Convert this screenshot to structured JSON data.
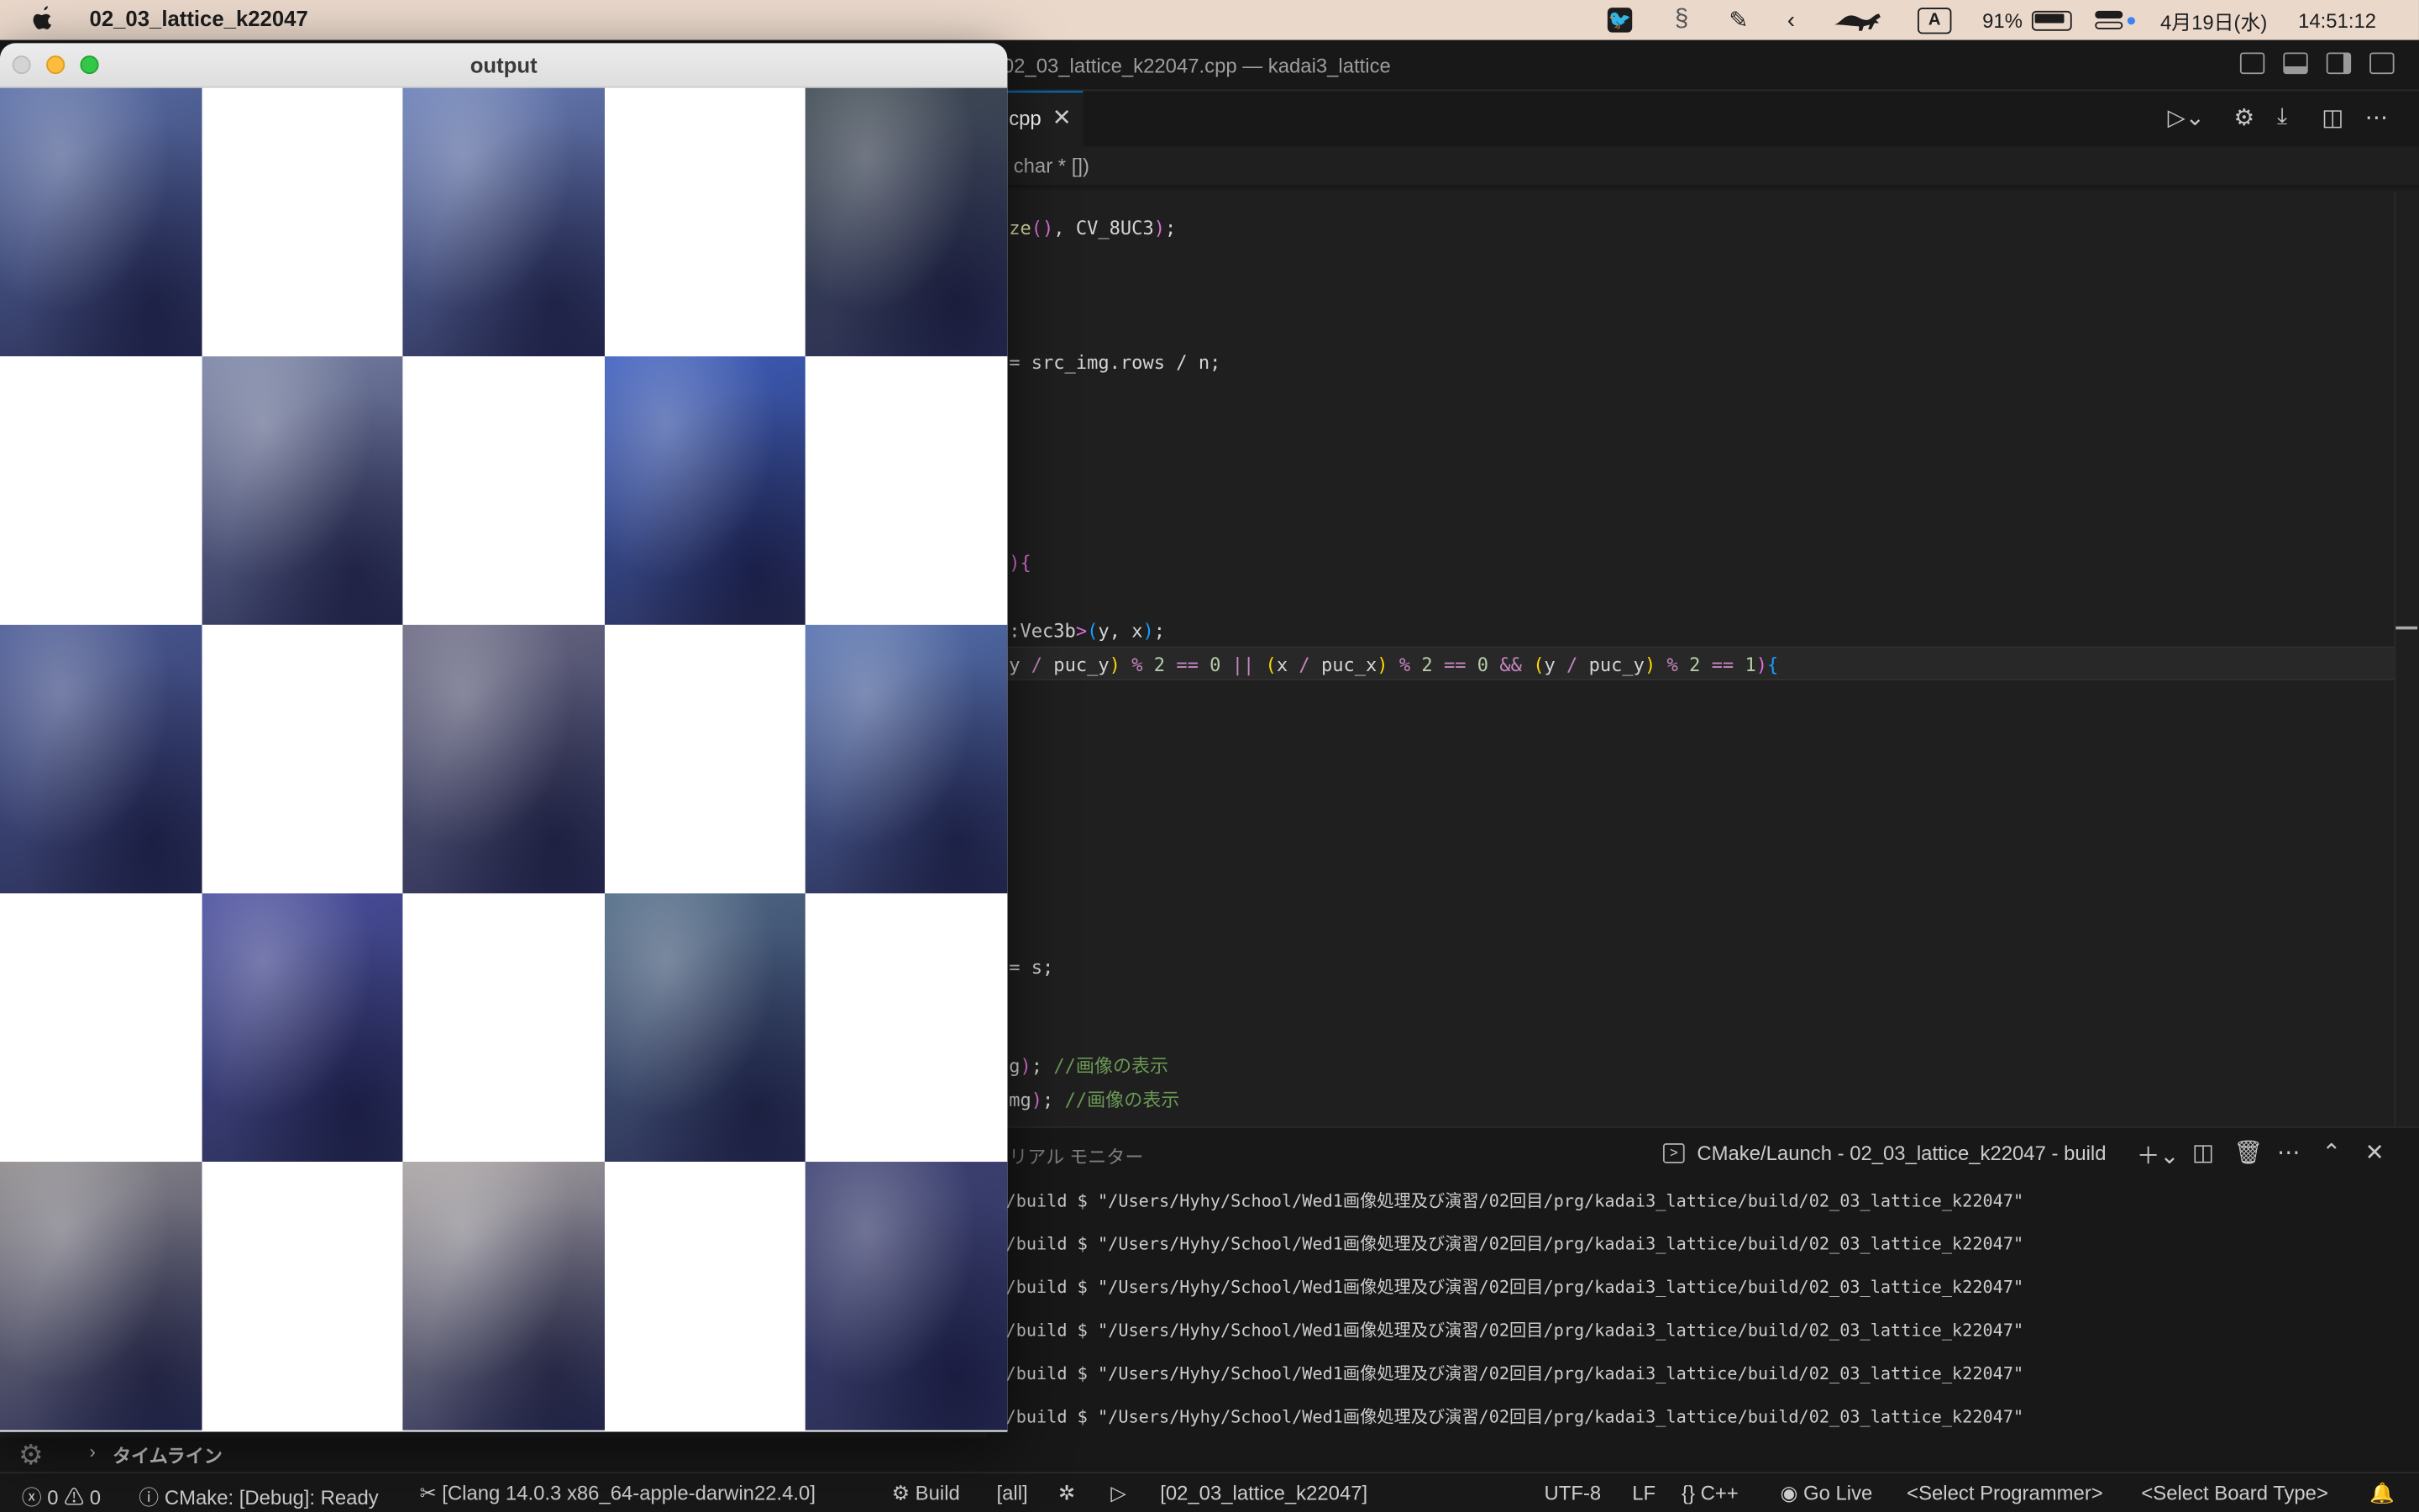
{
  "menubar": {
    "apple": "",
    "app_name": "02_03_lattice_k22047",
    "battery": "91%",
    "input_mode": "A",
    "date": "4月19日(水)",
    "time": "14:51:12"
  },
  "vscode": {
    "window_title": "02_03_lattice_k22047.cpp — kadai3_lattice",
    "tab_label": "cpp",
    "tab_close": "✕",
    "breadcrumb": "char * [])",
    "panel_tab": "リアル モニター",
    "terminal_name": "CMake/Launch - 02_03_lattice_k22047 - build",
    "terminal_lines": [
      "/build $ \"/Users/Hyhy/School/Wed1画像処理及び演習/02回目/prg/kadai3_lattice/build/02_03_lattice_k22047\"",
      "/build $ \"/Users/Hyhy/School/Wed1画像処理及び演習/02回目/prg/kadai3_lattice/build/02_03_lattice_k22047\"",
      "/build $ \"/Users/Hyhy/School/Wed1画像処理及び演習/02回目/prg/kadai3_lattice/build/02_03_lattice_k22047\"",
      "/build $ \"/Users/Hyhy/School/Wed1画像処理及び演習/02回目/prg/kadai3_lattice/build/02_03_lattice_k22047\"",
      "/build $ \"/Users/Hyhy/School/Wed1画像処理及び演習/02回目/prg/kadai3_lattice/build/02_03_lattice_k22047\"",
      "/build $ \"/Users/Hyhy/School/Wed1画像処理及び演習/02回目/prg/kadai3_lattice/build/02_03_lattice_k22047\""
    ],
    "timeline_label": "タイムライン"
  },
  "code_lines": [
    [
      {
        "t": "ze",
        "c": "#dcdcaa"
      },
      {
        "t": "()",
        "c": "#da70d6"
      },
      {
        "t": ", CV_8UC3",
        "c": "#d4d4d4"
      },
      {
        "t": ")",
        "c": "#da70d6"
      },
      {
        "t": ";",
        "c": "#d4d4d4"
      }
    ],
    [
      {
        "t": "= ",
        "c": "#d4d4d4"
      },
      {
        "t": "src_img",
        "c": "#d4d4d4"
      },
      {
        "t": ".rows ",
        "c": "#d4d4d4"
      },
      {
        "t": "/",
        "c": "#d4d4d4"
      },
      {
        "t": " n;",
        "c": "#d4d4d4"
      }
    ],
    [
      {
        "t": ")",
        "c": "#da70d6"
      },
      {
        "t": "{",
        "c": "#da70d6"
      }
    ],
    [
      {
        "t": ":Vec3b",
        "c": "#d4d4d4"
      },
      {
        "t": ">",
        "c": "#da70d6"
      },
      {
        "t": "(",
        "c": "#179fff"
      },
      {
        "t": "y, x",
        "c": "#d4d4d4"
      },
      {
        "t": ")",
        "c": "#179fff"
      },
      {
        "t": ";",
        "c": "#d4d4d4"
      }
    ],
    [
      {
        "t": "y ",
        "c": "#d4d4d4"
      },
      {
        "t": "/",
        "c": "#c586c0"
      },
      {
        "t": " puc_y",
        "c": "#d4d4d4"
      },
      {
        "t": ")",
        "c": "#ffd700"
      },
      {
        "t": " % ",
        "c": "#c586c0"
      },
      {
        "t": "2",
        "c": "#b5cea8"
      },
      {
        "t": " == ",
        "c": "#c586c0"
      },
      {
        "t": "0",
        "c": "#b5cea8"
      },
      {
        "t": " || ",
        "c": "#c586c0"
      },
      {
        "t": "(",
        "c": "#ffd700"
      },
      {
        "t": "x ",
        "c": "#d4d4d4"
      },
      {
        "t": "/",
        "c": "#c586c0"
      },
      {
        "t": " puc_x",
        "c": "#d4d4d4"
      },
      {
        "t": ")",
        "c": "#ffd700"
      },
      {
        "t": " % ",
        "c": "#c586c0"
      },
      {
        "t": "2",
        "c": "#b5cea8"
      },
      {
        "t": " == ",
        "c": "#c586c0"
      },
      {
        "t": "0",
        "c": "#b5cea8"
      },
      {
        "t": " && ",
        "c": "#c586c0"
      },
      {
        "t": "(",
        "c": "#ffd700"
      },
      {
        "t": "y ",
        "c": "#d4d4d4"
      },
      {
        "t": "/",
        "c": "#c586c0"
      },
      {
        "t": " puc_y",
        "c": "#d4d4d4"
      },
      {
        "t": ")",
        "c": "#ffd700"
      },
      {
        "t": " % ",
        "c": "#c586c0"
      },
      {
        "t": "2",
        "c": "#b5cea8"
      },
      {
        "t": " == ",
        "c": "#c586c0"
      },
      {
        "t": "1",
        "c": "#b5cea8"
      },
      {
        "t": ")",
        "c": "#da70d6"
      },
      {
        "t": "{",
        "c": "#179fff"
      }
    ],
    [
      {
        "t": "= ",
        "c": "#d4d4d4"
      },
      {
        "t": "s;",
        "c": "#d4d4d4"
      }
    ],
    [
      {
        "t": "g",
        "c": "#d4d4d4"
      },
      {
        "t": ")",
        "c": "#da70d6"
      },
      {
        "t": "; ",
        "c": "#d4d4d4"
      },
      {
        "t": "//画像の表示",
        "c": "#6a9955"
      }
    ],
    [
      {
        "t": "mg",
        "c": "#d4d4d4"
      },
      {
        "t": ")",
        "c": "#da70d6"
      },
      {
        "t": "; ",
        "c": "#d4d4d4"
      },
      {
        "t": "//画像の表示",
        "c": "#6a9955"
      }
    ]
  ],
  "status": {
    "errors": "0",
    "warnings": "0",
    "cmake": "CMake: [Debug]: Ready",
    "kit": "[Clang 14.0.3 x86_64-apple-darwin22.4.0]",
    "build": "Build",
    "target": "[all]",
    "launch_target": "[02_03_lattice_k22047]",
    "encoding": "UTF-8",
    "eol": "LF",
    "language": "C++",
    "go_live": "Go Live",
    "programmer": "<Select Programmer>",
    "board": "<Select Board Type>"
  },
  "output_window": {
    "title": "output",
    "cell_colors": [
      "#5a6fa8",
      "#6a7fb8",
      "#3f4a52",
      "#7a84a6",
      "#3d5fc0",
      "#4a5a96",
      "#6b6a84",
      "#5571b0",
      "#4a4fa0",
      "#4f6a86",
      "#8e8a8c",
      "#a9a3a2",
      "#3d4274"
    ]
  },
  "colors": {
    "statusbar": "#181818",
    "editor_bg": "#1f1f1f",
    "accent": "#0078d4",
    "menubar": "#ead8cb"
  }
}
